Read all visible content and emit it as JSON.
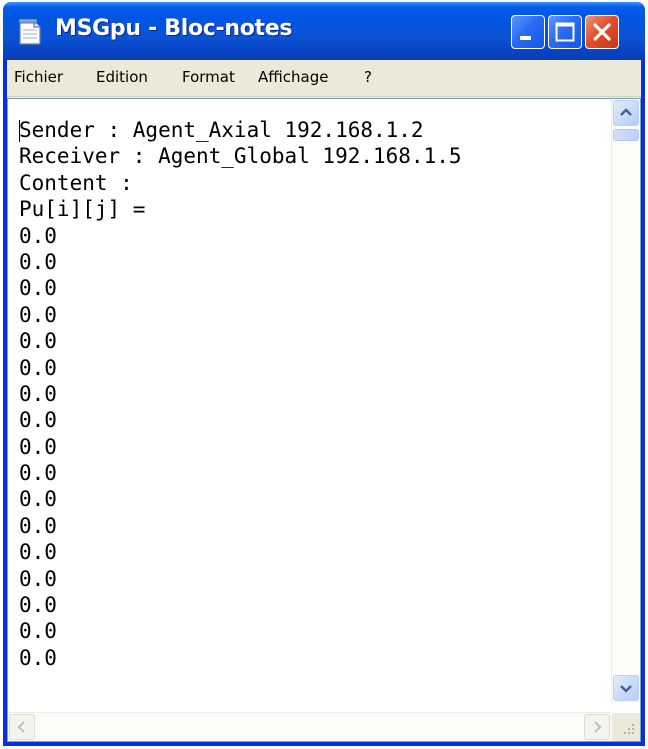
{
  "window": {
    "title": "MSGpu - Bloc-notes"
  },
  "menu": [
    {
      "label": "Fichier"
    },
    {
      "label": "Edition"
    },
    {
      "label": "Format"
    },
    {
      "label": "Affichage"
    },
    {
      "label": "?"
    }
  ],
  "document": {
    "lines": [
      "Sender : Agent_Axial 192.168.1.2",
      "Receiver : Agent_Global 192.168.1.5",
      "Content :",
      "Pu[i][j] =",
      "0.0",
      "0.0",
      "0.0",
      "0.0",
      "0.0",
      "0.0",
      "0.0",
      "0.0",
      "0.0",
      "0.0",
      "0.0",
      "0.0",
      "0.0",
      "0.0",
      "0.0",
      "0.0",
      "0.0"
    ]
  },
  "icons": {
    "app": "notepad-icon",
    "minimize": "minimize-icon",
    "maximize": "maximize-icon",
    "close": "close-icon",
    "scroll_up": "arrow-up-icon",
    "scroll_down": "arrow-down-icon",
    "scroll_left": "arrow-left-icon",
    "scroll_right": "arrow-right-icon",
    "resize": "resize-grip-icon"
  },
  "colors": {
    "titlebar": "#0055e5",
    "close_button": "#e0502a",
    "window_frame": "#0831d9",
    "chrome": "#ece9d8"
  }
}
